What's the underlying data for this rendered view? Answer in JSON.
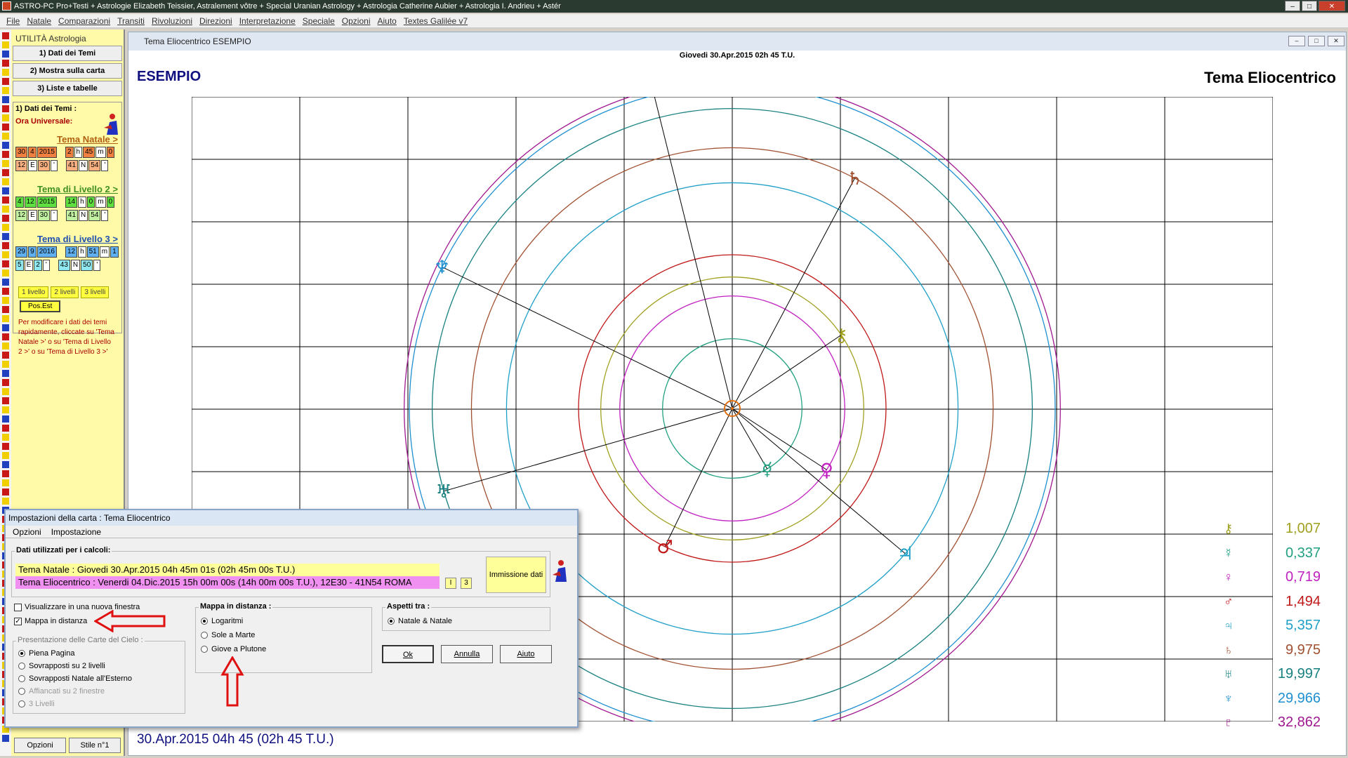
{
  "app": {
    "title": "ASTRO-PC Pro+Testi + Astrologie Elizabeth Teissier, Astralement vôtre + Special Uranian Astrology + Astrologia Catherine Aubier + Astrologia I. Andrieu + Astér"
  },
  "menu": [
    "File",
    "Natale",
    "Comparazioni",
    "Transiti",
    "Rivoluzioni",
    "Direzioni",
    "Interpretazione",
    "Speciale",
    "Opzioni",
    "Aiuto",
    "Textes Galilée v7"
  ],
  "left": {
    "title": "UTILITÀ Astrologia",
    "btn1": "1) Dati dei Temi",
    "btn2": "2) Mostra sulla carta",
    "btn3": "3) Liste e tabelle",
    "group_label": "1) Dati dei Temi :",
    "ora": "Ora Universale:",
    "natal": {
      "label": "Tema Natale >",
      "row1": [
        "30",
        "4",
        "2015",
        "2",
        "h",
        "45",
        "m",
        "0"
      ],
      "row2": [
        "12",
        "E",
        "30",
        "'",
        "41",
        "N",
        "54",
        "'"
      ]
    },
    "level2": {
      "label": "Tema di Livello 2 >",
      "row1": [
        "4",
        "12",
        "2015",
        "14",
        "h",
        "0",
        "m",
        "0"
      ],
      "row2": [
        "12",
        "E",
        "30",
        "'",
        "41",
        "N",
        "54",
        "'"
      ]
    },
    "level3": {
      "label": "Tema di Livello 3 >",
      "row1": [
        "29",
        "9",
        "2016",
        "12",
        "h",
        "51",
        "m",
        "1"
      ],
      "row2": [
        "5",
        "E",
        "2",
        "'",
        "43",
        "N",
        "50",
        "'"
      ]
    },
    "levels": [
      "1 livello",
      "2 livelli",
      "3 livelli"
    ],
    "posest": "Pos.Est",
    "note": "Per modificare i dati dei temi rapidamente, cliccate su 'Tema Natale >' o su 'Tema di Livello 2 >' o su 'Tema di Livello 3 >'",
    "bottom_opzioni": "Opzioni",
    "bottom_stile": "Stile n°1"
  },
  "chart_window": {
    "title": "Tema Eliocentrico  ESEMPIO",
    "date": "Giovedi 30.Apr.2015 02h 45 T.U.",
    "name": "ESEMPIO",
    "chart_title": "Tema Eliocentrico",
    "bottom_date": "30.Apr.2015 04h 45 (02h 45 T.U.)"
  },
  "chart_data": {
    "type": "heliocentric-orbits",
    "distances": [
      {
        "glyph": "⚷",
        "value": "1,007",
        "color": "#a0a020"
      },
      {
        "glyph": "☿",
        "value": "0,337",
        "color": "#20a080"
      },
      {
        "glyph": "♀",
        "value": "0,719",
        "color": "#c020c0"
      },
      {
        "glyph": "♂",
        "value": "1,494",
        "color": "#c01818"
      },
      {
        "glyph": "♃",
        "value": "5,357",
        "color": "#20a0c8"
      },
      {
        "glyph": "♄",
        "value": "9,975",
        "color": "#a05030"
      },
      {
        "glyph": "♅",
        "value": "19,997",
        "color": "#188080"
      },
      {
        "glyph": "♆",
        "value": "29,966",
        "color": "#2090d0"
      },
      {
        "glyph": "♇",
        "value": "32,862",
        "color": "#a01890"
      }
    ],
    "planets": [
      {
        "glyph": "♇",
        "lon": 104,
        "color": "#a01890"
      },
      {
        "glyph": "♄",
        "lon": 62,
        "color": "#a05030"
      },
      {
        "glyph": "♆",
        "lon": 154,
        "color": "#2090d0"
      },
      {
        "glyph": "⚷",
        "lon": 34,
        "color": "#a0a020"
      },
      {
        "glyph": "♅",
        "lon": 196,
        "color": "#188080"
      },
      {
        "glyph": "☿",
        "lon": 300,
        "color": "#20a080"
      },
      {
        "glyph": "♀",
        "lon": 327,
        "color": "#c020c0"
      },
      {
        "glyph": "♂",
        "lon": 244,
        "color": "#c01818"
      },
      {
        "glyph": "♃",
        "lon": 320,
        "color": "#20a0c8"
      }
    ]
  },
  "dialog": {
    "title": "Impostazioni della carta : Tema Eliocentrico",
    "menu": [
      "Opzioni",
      "Impostazione"
    ],
    "dati_label": "Dati utilizzati per i calcoli:",
    "line1": "Tema Natale : Giovedi 30.Apr.2015 04h 45m 01s (02h 45m 00s T.U.)",
    "line2": "Tema Eliocentrico : Venerdi 04.Dic.2015 15h 00m 00s (14h 00m 00s T.U.), 12E30 - 41N54  ROMA",
    "btn_1": "I",
    "btn_3": "3",
    "immissione": "Immissione dati",
    "chk_new": "Visualizzare in una nuova finestra",
    "chk_map": "Mappa in distanza",
    "pres_label": "Presentazione delle Carte del Cielo :",
    "pres": [
      "Piena Pagina",
      "Sovrapposti su 2 livelli",
      "Sovrapposti Natale all'Esterno",
      "Affiancati su 2 finestre",
      "3 Livelli"
    ],
    "map_label": "Mappa in distanza :",
    "map": [
      "Logaritmi",
      "Sole a Marte",
      "Giove a Plutone"
    ],
    "asp_label": "Aspetti tra :",
    "asp": "Natale & Natale",
    "ok": "Ok",
    "annulla": "Annulla",
    "aiuto": "Aiuto"
  }
}
